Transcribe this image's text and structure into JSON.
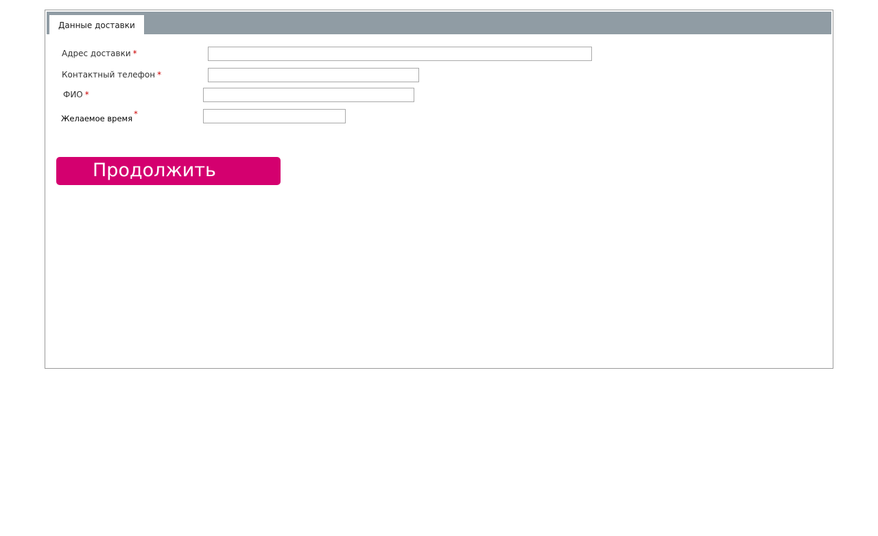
{
  "tabs": [
    {
      "label": "Данные доставки"
    }
  ],
  "form": {
    "address": {
      "label": "Адрес доставки",
      "required_mark": "*",
      "value": ""
    },
    "phone": {
      "label": "Контактный телефон",
      "required_mark": "*",
      "value": ""
    },
    "fio": {
      "label": "ФИО",
      "required_mark": "*",
      "value": ""
    },
    "time": {
      "label": "Желаемое время",
      "required_mark": "*",
      "value": ""
    }
  },
  "submit": {
    "label": "Продолжить"
  },
  "colors": {
    "tabbar": "#909ca4",
    "button": "#d4006f",
    "required": "#cc0000"
  }
}
